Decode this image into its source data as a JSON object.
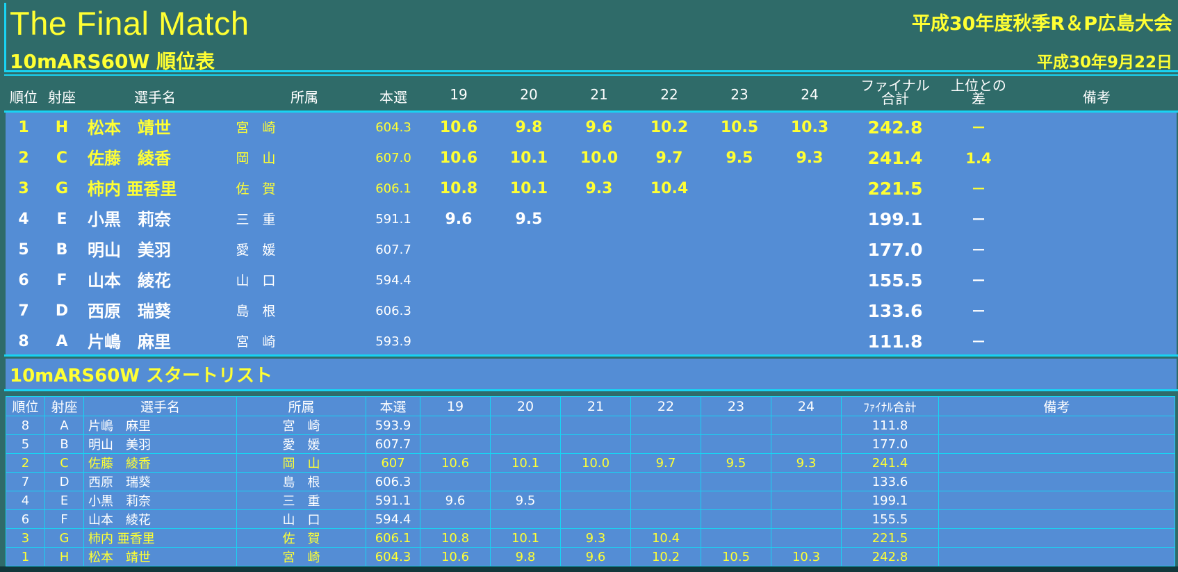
{
  "header": {
    "title": "The Final Match",
    "subtitle": "10mARS60W 順位表",
    "event": "平成30年度秋季R＆P広島大会",
    "date": "平成30年9月22日"
  },
  "ranking": {
    "columns": [
      "順位",
      "射座",
      "選手名",
      "所属",
      "本選",
      "19",
      "20",
      "21",
      "22",
      "23",
      "24",
      "ファイナル\n合計",
      "上位との\n差",
      "備考"
    ],
    "col_final_l1": "ファイナル",
    "col_final_l2": "合計",
    "col_diff_l1": "上位との",
    "col_diff_l2": "差",
    "rows": [
      {
        "rank": "1",
        "seat": "H",
        "name": "松本　靖世",
        "club": "宮　崎",
        "main": "604.3",
        "s19": "10.6",
        "s20": "9.8",
        "s21": "9.6",
        "s22": "10.2",
        "s23": "10.5",
        "s24": "10.3",
        "total": "242.8",
        "diff": "－",
        "remark": "",
        "active": true
      },
      {
        "rank": "2",
        "seat": "C",
        "name": "佐藤　綾香",
        "club": "岡　山",
        "main": "607.0",
        "s19": "10.6",
        "s20": "10.1",
        "s21": "10.0",
        "s22": "9.7",
        "s23": "9.5",
        "s24": "9.3",
        "total": "241.4",
        "diff": "1.4",
        "remark": "",
        "active": true
      },
      {
        "rank": "3",
        "seat": "G",
        "name": "柿内 亜香里",
        "club": "佐　賀",
        "main": "606.1",
        "s19": "10.8",
        "s20": "10.1",
        "s21": "9.3",
        "s22": "10.4",
        "s23": "",
        "s24": "",
        "total": "221.5",
        "diff": "－",
        "remark": "",
        "active": true
      },
      {
        "rank": "4",
        "seat": "E",
        "name": "小黒　莉奈",
        "club": "三　重",
        "main": "591.1",
        "s19": "9.6",
        "s20": "9.5",
        "s21": "",
        "s22": "",
        "s23": "",
        "s24": "",
        "total": "199.1",
        "diff": "－",
        "remark": "",
        "active": false
      },
      {
        "rank": "5",
        "seat": "B",
        "name": "明山　美羽",
        "club": "愛　媛",
        "main": "607.7",
        "s19": "",
        "s20": "",
        "s21": "",
        "s22": "",
        "s23": "",
        "s24": "",
        "total": "177.0",
        "diff": "－",
        "remark": "",
        "active": false
      },
      {
        "rank": "6",
        "seat": "F",
        "name": "山本　綾花",
        "club": "山　口",
        "main": "594.4",
        "s19": "",
        "s20": "",
        "s21": "",
        "s22": "",
        "s23": "",
        "s24": "",
        "total": "155.5",
        "diff": "－",
        "remark": "",
        "active": false
      },
      {
        "rank": "7",
        "seat": "D",
        "name": "西原　瑞葵",
        "club": "島　根",
        "main": "606.3",
        "s19": "",
        "s20": "",
        "s21": "",
        "s22": "",
        "s23": "",
        "s24": "",
        "total": "133.6",
        "diff": "－",
        "remark": "",
        "active": false
      },
      {
        "rank": "8",
        "seat": "A",
        "name": "片嶋　麻里",
        "club": "宮　崎",
        "main": "593.9",
        "s19": "",
        "s20": "",
        "s21": "",
        "s22": "",
        "s23": "",
        "s24": "",
        "total": "111.8",
        "diff": "－",
        "remark": "",
        "active": false
      }
    ]
  },
  "startlist": {
    "title": "10mARS60W スタートリスト",
    "columns": [
      "順位",
      "射座",
      "選手名",
      "所属",
      "本選",
      "19",
      "20",
      "21",
      "22",
      "23",
      "24",
      "ﾌｧｲﾅﾙ合計",
      "備考"
    ],
    "rows": [
      {
        "rank": "8",
        "seat": "A",
        "name": "片嶋　麻里",
        "club": "宮　崎",
        "main": "593.9",
        "s19": "",
        "s20": "",
        "s21": "",
        "s22": "",
        "s23": "",
        "s24": "",
        "total": "111.8",
        "remark": "",
        "active": false
      },
      {
        "rank": "5",
        "seat": "B",
        "name": "明山　美羽",
        "club": "愛　媛",
        "main": "607.7",
        "s19": "",
        "s20": "",
        "s21": "",
        "s22": "",
        "s23": "",
        "s24": "",
        "total": "177.0",
        "remark": "",
        "active": false
      },
      {
        "rank": "2",
        "seat": "C",
        "name": "佐藤　綾香",
        "club": "岡　山",
        "main": "607",
        "s19": "10.6",
        "s20": "10.1",
        "s21": "10.0",
        "s22": "9.7",
        "s23": "9.5",
        "s24": "9.3",
        "total": "241.4",
        "remark": "",
        "active": true
      },
      {
        "rank": "7",
        "seat": "D",
        "name": "西原　瑞葵",
        "club": "島　根",
        "main": "606.3",
        "s19": "",
        "s20": "",
        "s21": "",
        "s22": "",
        "s23": "",
        "s24": "",
        "total": "133.6",
        "remark": "",
        "active": false
      },
      {
        "rank": "4",
        "seat": "E",
        "name": "小黒　莉奈",
        "club": "三　重",
        "main": "591.1",
        "s19": "9.6",
        "s20": "9.5",
        "s21": "",
        "s22": "",
        "s23": "",
        "s24": "",
        "total": "199.1",
        "remark": "",
        "active": false
      },
      {
        "rank": "6",
        "seat": "F",
        "name": "山本　綾花",
        "club": "山　口",
        "main": "594.4",
        "s19": "",
        "s20": "",
        "s21": "",
        "s22": "",
        "s23": "",
        "s24": "",
        "total": "155.5",
        "remark": "",
        "active": false
      },
      {
        "rank": "3",
        "seat": "G",
        "name": "柿内 亜香里",
        "club": "佐　賀",
        "main": "606.1",
        "s19": "10.8",
        "s20": "10.1",
        "s21": "9.3",
        "s22": "10.4",
        "s23": "",
        "s24": "",
        "total": "221.5",
        "remark": "",
        "active": true
      },
      {
        "rank": "1",
        "seat": "H",
        "name": "松本　靖世",
        "club": "宮　崎",
        "main": "604.3",
        "s19": "10.6",
        "s20": "9.8",
        "s21": "9.6",
        "s22": "10.2",
        "s23": "10.5",
        "s24": "10.3",
        "total": "242.8",
        "remark": "",
        "active": true
      }
    ]
  },
  "colors": {
    "background": "#2f6b69",
    "panel": "#548dd5",
    "accent_line": "#19d3f2",
    "highlight": "#ffff33",
    "text": "#ffffff"
  }
}
